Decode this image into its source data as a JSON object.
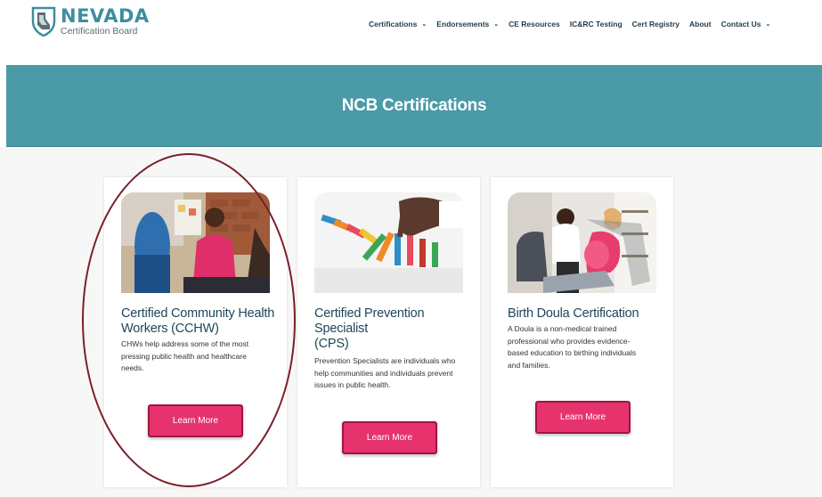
{
  "logo": {
    "main": "NEVADA",
    "sub": "Certification Board",
    "icon": "nevada-shield-icon"
  },
  "nav": {
    "items": [
      {
        "label": "Certifications",
        "has_dropdown": true
      },
      {
        "label": "Endorsements",
        "has_dropdown": true
      },
      {
        "label": "CE Resources",
        "has_dropdown": false
      },
      {
        "label": "IC&RC Testing",
        "has_dropdown": false
      },
      {
        "label": "Cert Registry",
        "has_dropdown": false
      },
      {
        "label": "About",
        "has_dropdown": false
      },
      {
        "label": "Contact Us",
        "has_dropdown": true
      }
    ],
    "caret": "⌄"
  },
  "banner": {
    "title": "NCB Certifications"
  },
  "cards": [
    {
      "title": "Certified Community Health Workers (CCHW)",
      "desc": "CHWs help address some of the most pressing public health and healthcare needs.",
      "button": "Learn More"
    },
    {
      "title_lines": [
        "Certified Prevention",
        "Specialist",
        "(CPS)"
      ],
      "desc": "Prevention Specialists are individuals who help communities and individuals prevent issues in public health.",
      "button": "Learn More"
    },
    {
      "title": "Birth Doula Certification",
      "desc": "A Doula is a non-medical trained professional who provides evidence-based education to birthing individuals and families.",
      "button": "Learn More"
    }
  ],
  "colors": {
    "banner": "#4a9aa8",
    "button": "#e6336d",
    "title": "#1f4658",
    "annotation": "#7a1f2b"
  }
}
